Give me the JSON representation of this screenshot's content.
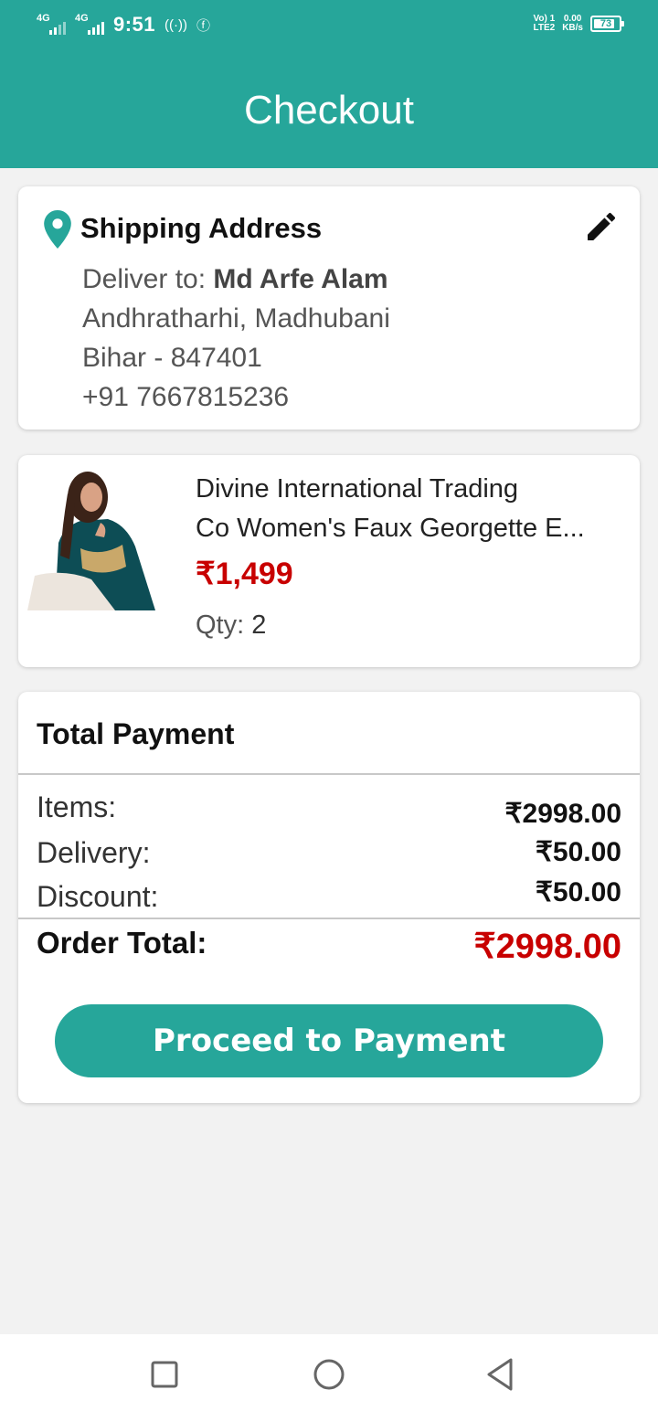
{
  "status_bar": {
    "signal1": "4G",
    "signal2": "4G",
    "time": "9:51",
    "volte_line1": "Vo) 1",
    "volte_line2": "LTE2",
    "speed_value": "0.00",
    "speed_unit": "KB/s",
    "battery": "73"
  },
  "header": {
    "title": "Checkout"
  },
  "shipping": {
    "heading": "Shipping Address",
    "deliver_label": "Deliver to:",
    "name": "Md Arfe Alam",
    "line1": "Andhratharhi, Madhubani",
    "line2": "Bihar - 847401",
    "phone": "+91 7667815236"
  },
  "product": {
    "name_line1": "Divine International Trading",
    "name_line2": "Co Women's Faux Georgette E...",
    "price": "₹1,499",
    "qty_label": "Qty:",
    "qty_value": "2"
  },
  "payment": {
    "heading": "Total Payment",
    "items_label": "Items:",
    "items_value": "₹2998.00",
    "delivery_label": "Delivery:",
    "delivery_value": "₹50.00",
    "discount_label": "Discount:",
    "discount_value": "₹50.00",
    "total_label": "Order Total:",
    "total_value": "₹2998.00",
    "button_label": "Proceed to Payment"
  },
  "nav": {
    "icons": [
      "recent-apps-icon",
      "home-icon",
      "back-icon"
    ]
  },
  "colors": {
    "accent": "#26a69a",
    "price_red": "#c80000",
    "background": "#f2f2f2"
  }
}
